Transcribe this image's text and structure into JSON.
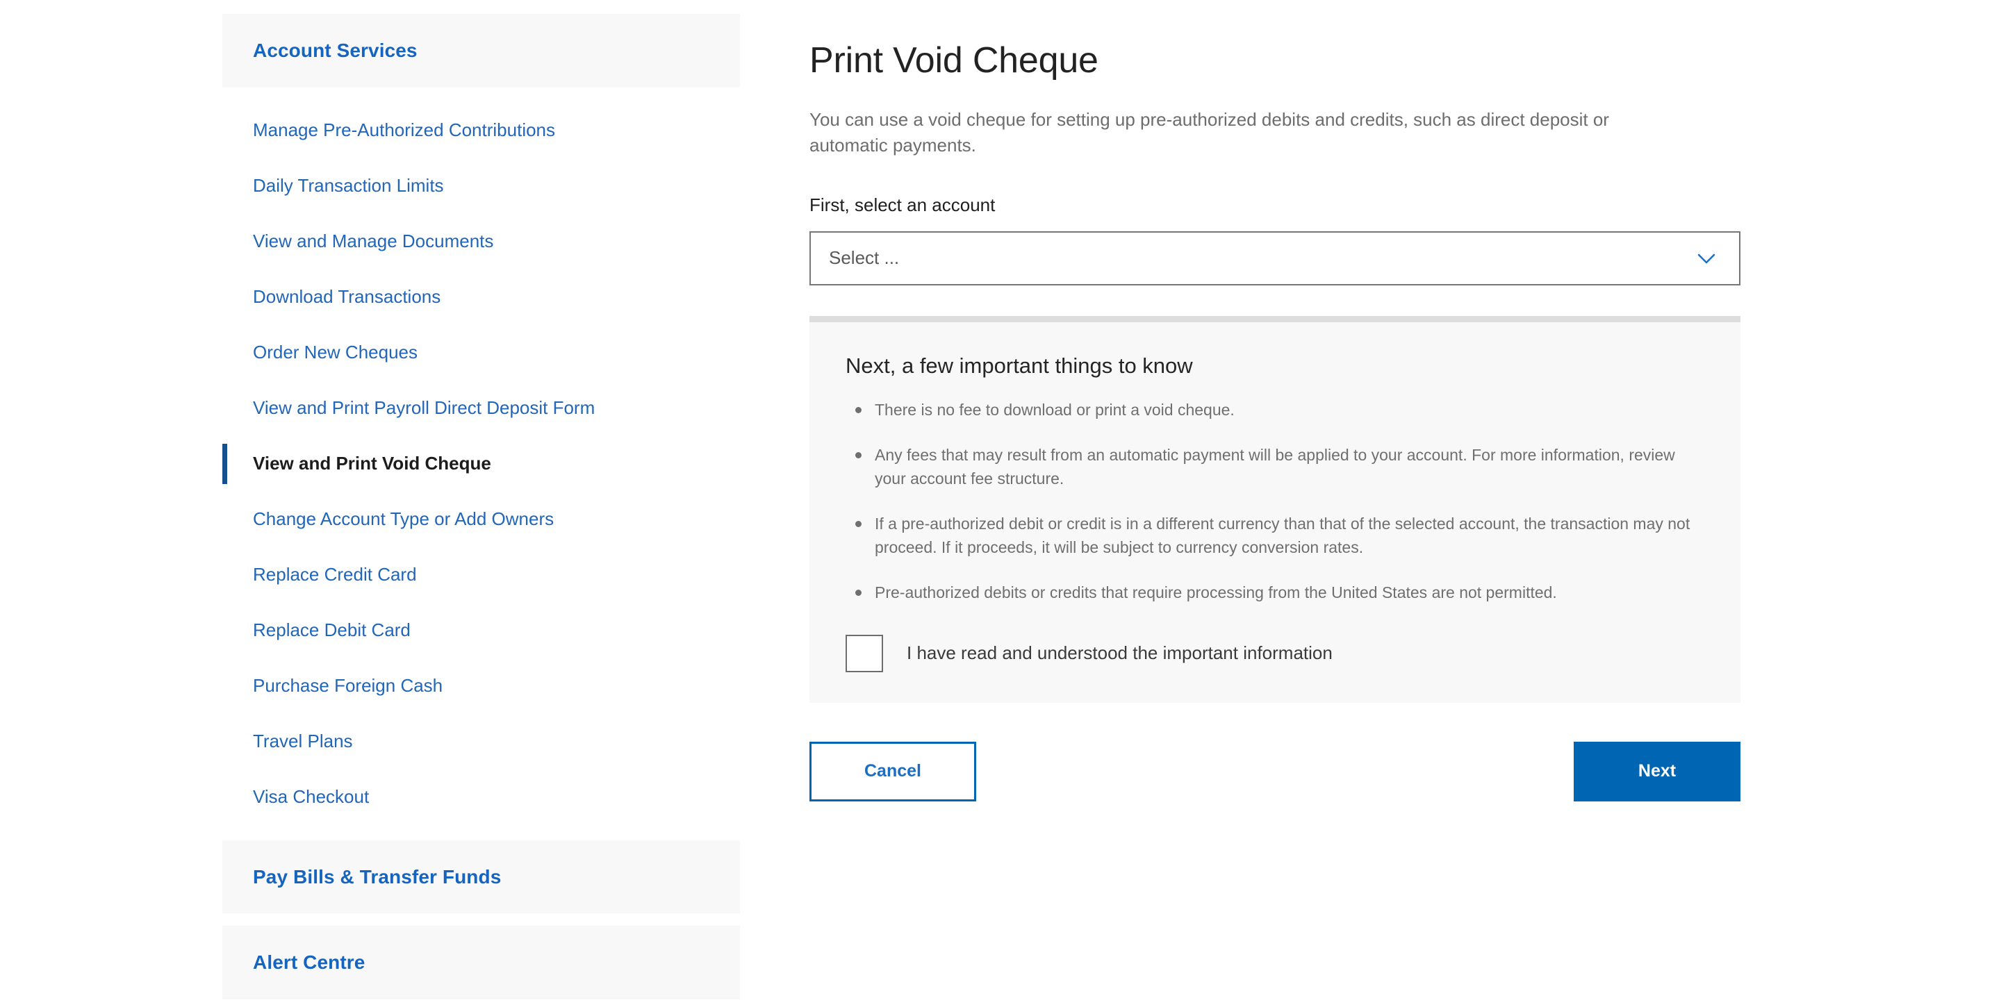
{
  "sidebar": {
    "sections": [
      {
        "id": "account-services",
        "title": "Account Services",
        "items": [
          {
            "label": "Manage Pre-Authorized Contributions",
            "active": false
          },
          {
            "label": "Daily Transaction Limits",
            "active": false
          },
          {
            "label": "View and Manage Documents",
            "active": false
          },
          {
            "label": "Download Transactions",
            "active": false
          },
          {
            "label": "Order New Cheques",
            "active": false
          },
          {
            "label": "View and Print Payroll Direct Deposit Form",
            "active": false
          },
          {
            "label": "View and Print Void Cheque",
            "active": true
          },
          {
            "label": "Change Account Type or Add Owners",
            "active": false
          },
          {
            "label": "Replace Credit Card",
            "active": false
          },
          {
            "label": "Replace Debit Card",
            "active": false
          },
          {
            "label": "Purchase Foreign Cash",
            "active": false
          },
          {
            "label": "Travel Plans",
            "active": false
          },
          {
            "label": "Visa Checkout",
            "active": false
          }
        ]
      },
      {
        "id": "pay-bills-transfer-funds",
        "title": "Pay Bills & Transfer Funds",
        "items": []
      },
      {
        "id": "alert-centre",
        "title": "Alert Centre",
        "items": []
      }
    ]
  },
  "main": {
    "title": "Print Void Cheque",
    "intro": "You can use a void cheque for setting up pre-authorized debits and credits, such as direct deposit or automatic payments.",
    "account_field": {
      "label": "First, select an account",
      "selected_value": "Select ...",
      "chevron_icon": "chevron-down-icon"
    },
    "info_panel": {
      "heading": "Next, a few important things to know",
      "bullets": [
        "There is no fee to download or print a void cheque.",
        "Any fees that may result from an automatic payment will be applied to your account. For more information, review your account fee structure.",
        "If a pre-authorized debit or credit is in a different currency than that of the selected account, the transaction may not proceed. If it proceeds, it will be subject to currency conversion rates.",
        "Pre-authorized debits or credits that require processing from the United States are not permitted."
      ],
      "acknowledgement": {
        "label": "I have read and understood the important information",
        "checked": false
      }
    },
    "actions": {
      "cancel_label": "Cancel",
      "next_label": "Next"
    }
  },
  "colors": {
    "link_blue": "#2166b8",
    "section_title_blue": "#1565c0",
    "active_accent": "#17508f",
    "primary_button": "#0065b3",
    "panel_background": "#f8f8f8",
    "panel_top_border": "#dddddd",
    "select_border": "#767676"
  }
}
